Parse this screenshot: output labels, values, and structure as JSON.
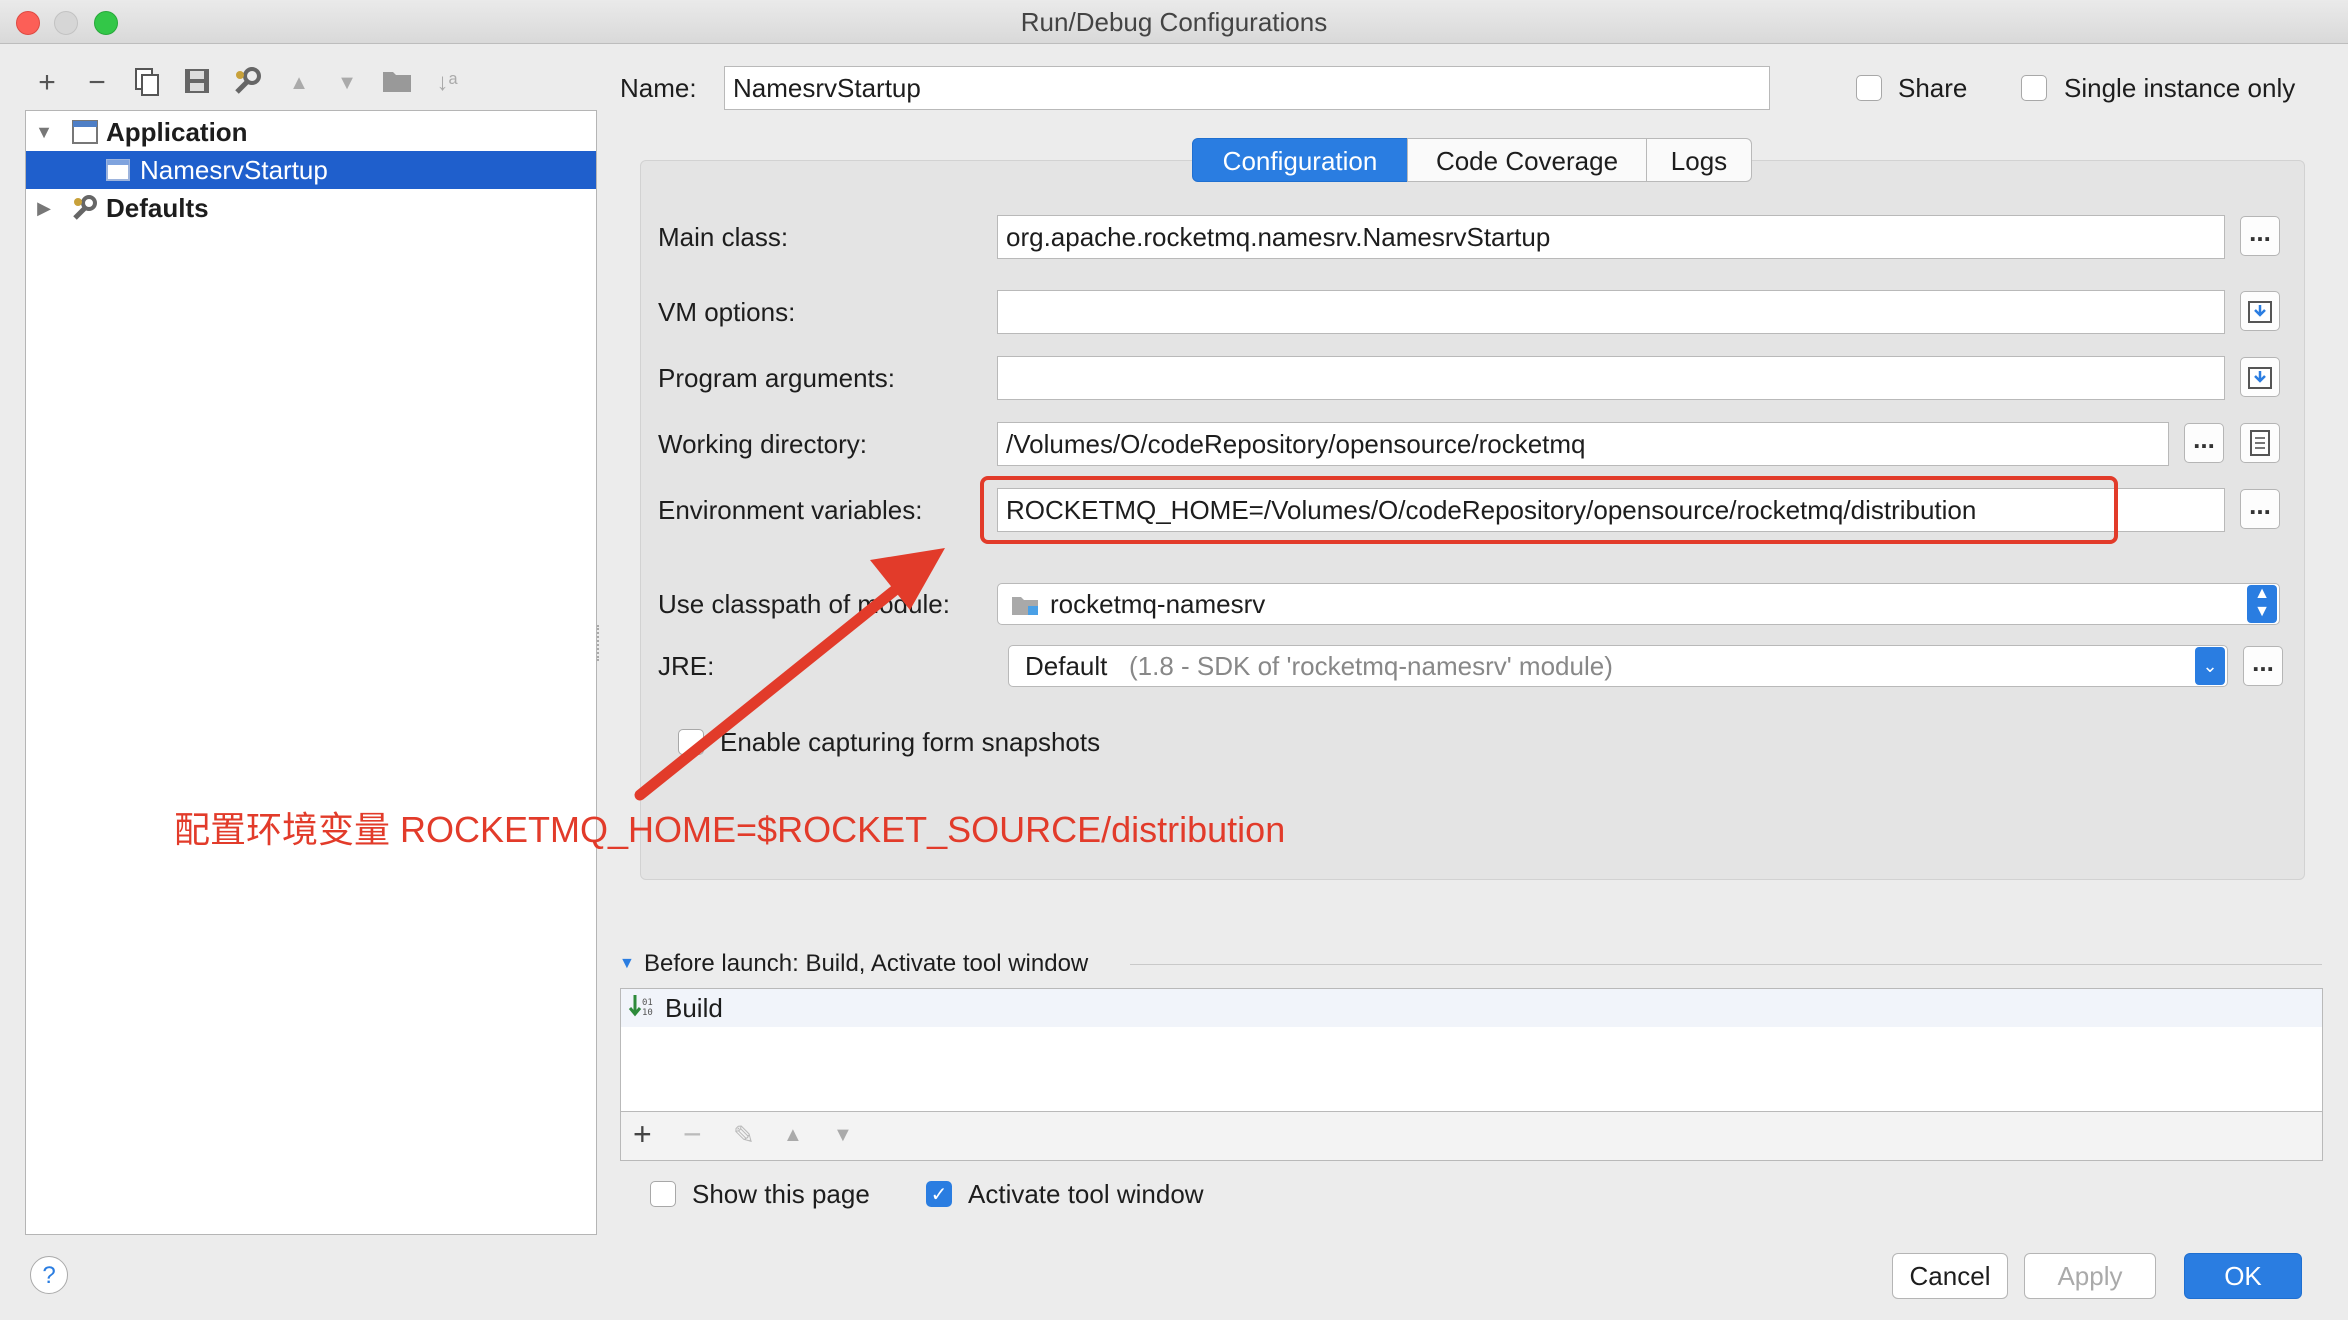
{
  "window": {
    "title": "Run/Debug Configurations"
  },
  "toolbar": {
    "icons": [
      "add-icon",
      "remove-icon",
      "copy-icon",
      "save-icon",
      "wrench-icon",
      "move-up-icon",
      "move-down-icon",
      "folder-icon",
      "sort-icon"
    ],
    "glyphs": [
      "+",
      "−",
      "⎘",
      "💾",
      "🔧",
      "▲",
      "▼",
      "▬",
      "↓"
    ]
  },
  "tree": {
    "application_label": "Application",
    "selected_item": "NamesrvStartup",
    "defaults_label": "Defaults"
  },
  "header": {
    "name_label": "Name:",
    "name_value": "NamesrvStartup",
    "share_label": "Share",
    "single_instance_label": "Single instance only"
  },
  "tabs": [
    {
      "label": "Configuration",
      "selected": true
    },
    {
      "label": "Code Coverage",
      "selected": false
    },
    {
      "label": "Logs",
      "selected": false
    }
  ],
  "form": {
    "main_class_label": "Main class:",
    "main_class_value": "org.apache.rocketmq.namesrv.NamesrvStartup",
    "vm_options_label": "VM options:",
    "vm_options_value": "",
    "program_args_label": "Program arguments:",
    "program_args_value": "",
    "working_dir_label": "Working directory:",
    "working_dir_value": "/Volumes/O/codeRepository/opensource/rocketmq",
    "env_vars_label": "Environment variables:",
    "env_vars_value": "ROCKETMQ_HOME=/Volumes/O/codeRepository/opensource/rocketmq/distribution",
    "classpath_label": "Use classpath of module:",
    "classpath_value": "rocketmq-namesrv",
    "jre_label": "JRE:",
    "jre_value": "Default",
    "jre_detail": "(1.8 - SDK of 'rocketmq-namesrv' module)",
    "snapshots_label": "Enable capturing form snapshots",
    "ellipsis": "..."
  },
  "annotation": {
    "text": "配置环境变量 ROCKETMQ_HOME=$ROCKET_SOURCE/distribution",
    "color": "#e23b2a"
  },
  "before_launch": {
    "header": "Before launch: Build, Activate tool window",
    "items": [
      "Build"
    ]
  },
  "footer": {
    "show_page_label": "Show this page",
    "activate_tool_label": "Activate tool window",
    "help_label": "?",
    "cancel_label": "Cancel",
    "apply_label": "Apply",
    "ok_label": "OK"
  },
  "colors": {
    "accent": "#2a7de1",
    "selection": "#1f5fcc",
    "annotation": "#e23b2a"
  }
}
